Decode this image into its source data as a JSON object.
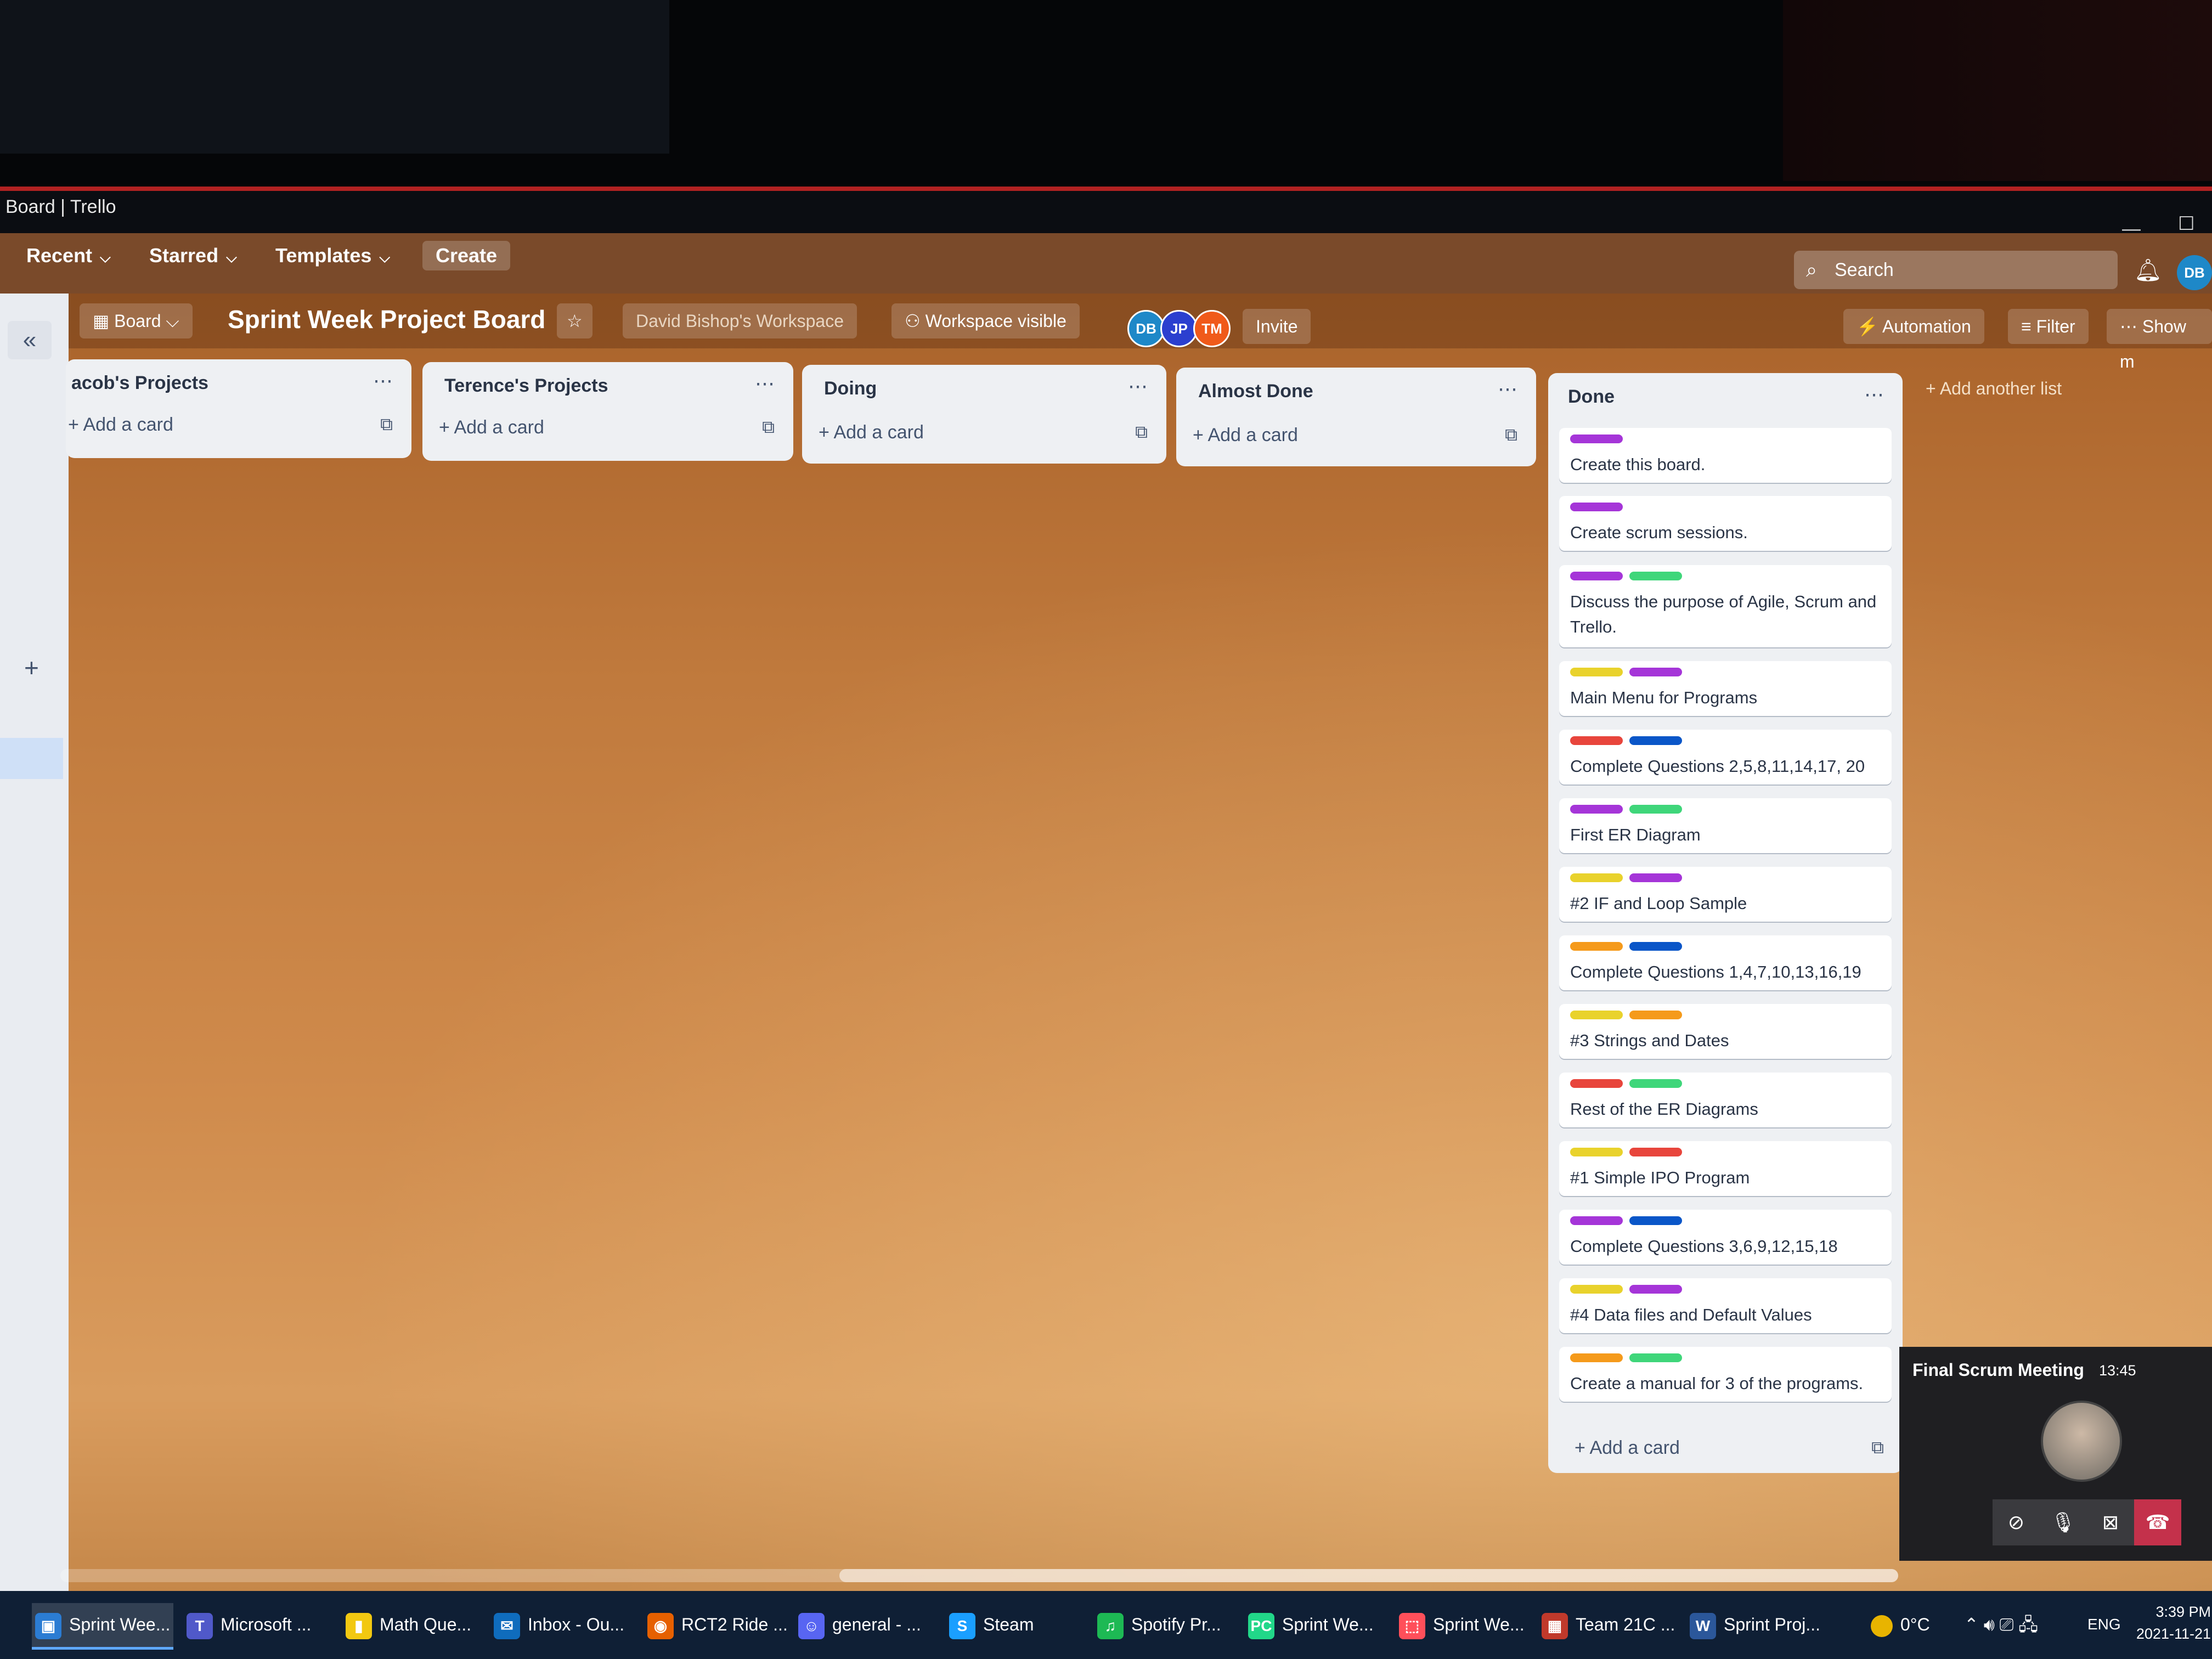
{
  "window": {
    "title": "Board | Trello"
  },
  "header": {
    "nav": [
      "Recent",
      "Starred",
      "Templates"
    ],
    "create_label": "Create",
    "search_label": "Search",
    "avatar": "DB"
  },
  "boardbar": {
    "view_label": "Board",
    "title": "Sprint Week Project Board",
    "workspace": "David Bishop's Workspace",
    "visibility": "Workspace visible",
    "members": [
      "DB",
      "JP",
      "TM"
    ],
    "invite_label": "Invite",
    "automation_label": "Automation",
    "filter_label": "Filter",
    "show_label": "Show m"
  },
  "lists": [
    {
      "name": "acob's Projects",
      "add_label": "Add a card"
    },
    {
      "name": "Terence's Projects",
      "add_label": "Add a card"
    },
    {
      "name": "Doing",
      "add_label": "Add a card"
    },
    {
      "name": "Almost Done",
      "add_label": "Add a card"
    }
  ],
  "done_list": {
    "name": "Done",
    "add_label": "Add a card",
    "cards": [
      {
        "text": "Create this board.",
        "labels": [
          "#a535d8"
        ]
      },
      {
        "text": "Create scrum sessions.",
        "labels": [
          "#a535d8"
        ]
      },
      {
        "text": "Discuss the purpose of Agile, Scrum and Trello.",
        "labels": [
          "#a535d8",
          "#3fd67a"
        ]
      },
      {
        "text": "Main Menu for Programs",
        "labels": [
          "#e9d22c",
          "#a535d8"
        ]
      },
      {
        "text": "Complete Questions 2,5,8,11,14,17, 20",
        "labels": [
          "#e8453c",
          "#0a56c8"
        ]
      },
      {
        "text": "First ER Diagram",
        "labels": [
          "#a535d8",
          "#3fd67a"
        ]
      },
      {
        "text": "#2 IF and Loop Sample",
        "labels": [
          "#e9d22c",
          "#a535d8"
        ]
      },
      {
        "text": "Complete Questions 1,4,7,10,13,16,19",
        "labels": [
          "#f59a1b",
          "#0a56c8"
        ]
      },
      {
        "text": "#3 Strings and Dates",
        "labels": [
          "#e9d22c",
          "#f59a1b"
        ]
      },
      {
        "text": "Rest of the ER Diagrams",
        "labels": [
          "#e8453c",
          "#3fd67a"
        ]
      },
      {
        "text": "#1 Simple IPO Program",
        "labels": [
          "#e9d22c",
          "#e8453c"
        ]
      },
      {
        "text": "Complete Questions 3,6,9,12,15,18",
        "labels": [
          "#a535d8",
          "#0a56c8"
        ]
      },
      {
        "text": "#4 Data files and Default Values",
        "labels": [
          "#e9d22c",
          "#a535d8"
        ]
      },
      {
        "text": "Create a manual for 3 of the programs.",
        "labels": [
          "#f59a1b",
          "#3fd67a"
        ]
      }
    ]
  },
  "add_list_label": "Add another list",
  "teams": {
    "title": "Final Scrum Meeting",
    "time": "13:45"
  },
  "taskbar": {
    "items": [
      "Sprint Wee...",
      "Microsoft ...",
      "Math Que...",
      "Inbox - Ou...",
      "RCT2 Ride ...",
      "general - ...",
      "Steam",
      "Spotify Pr...",
      "Sprint We...",
      "Sprint We...",
      "Team 21C ...",
      "Sprint Proj..."
    ],
    "temperature": "0°C",
    "language": "ENG",
    "time": "3:39 PM",
    "date": "2021-11-21"
  },
  "colors": {
    "header": "#7a4a2a",
    "sidebar": "#e9ecf1",
    "taskbar": "#0f1f35",
    "accent_red": "#b22222"
  }
}
